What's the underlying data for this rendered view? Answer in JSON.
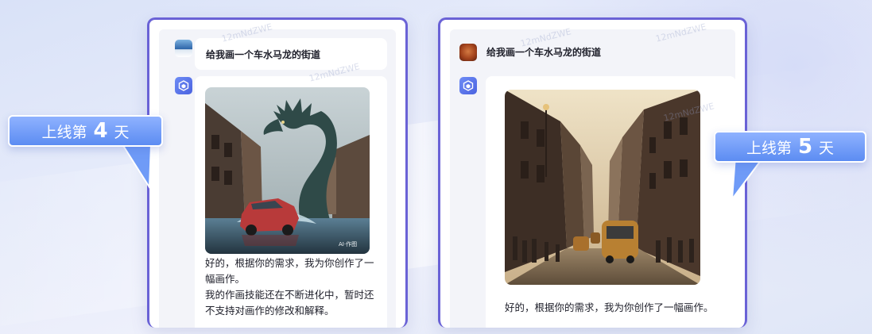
{
  "left_card": {
    "prompt": "给我画一个车水马龙的街道",
    "reply_lines": [
      "好的，根据你的需求，我为你创作了一",
      "幅画作。",
      "我的作画技能还在不断进化中，暂时还",
      "不支持对画作的修改和解释。"
    ],
    "image_badge": "AI·作图",
    "image_subject": "dragon-street-illustration"
  },
  "right_card": {
    "prompt": "给我画一个车水马龙的街道",
    "reply": "好的，根据你的需求，我为你创作了一幅画作。",
    "image_subject": "old-town-street-illustration"
  },
  "callout_left": {
    "prefix": "上线第",
    "number": "4",
    "suffix": "天"
  },
  "callout_right": {
    "prefix": "上线第",
    "number": "5",
    "suffix": "天"
  },
  "watermark": "12mNdZWE",
  "colors": {
    "accent": "#6a62d6",
    "callout": "#6f9bf7",
    "panel": "#f3f4f9"
  },
  "icons": [
    "user-landscape-avatar",
    "user-bread-avatar",
    "bot-cube-icon"
  ]
}
